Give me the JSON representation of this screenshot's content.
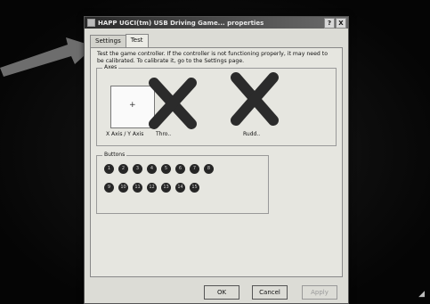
{
  "window": {
    "title": "HAPP UGCI(tm) USB Driving Game... properties",
    "help_label": "?",
    "close_label": "X"
  },
  "tabs": [
    {
      "label": "Settings",
      "active": false
    },
    {
      "label": "Test",
      "active": true
    }
  ],
  "test_panel": {
    "intro": "Test the game controller. If the controller is not functioning properly, it may need to be calibrated. To calibrate it, go to the Settings page.",
    "axes": {
      "label": "Axes",
      "xy_label": "X Axis / Y Axis",
      "crosshair": "+",
      "throttle_label": "Thro..",
      "rudder_label": "Rudd.."
    },
    "buttons": {
      "label": "Buttons",
      "items": [
        "1",
        "2",
        "3",
        "4",
        "5",
        "6",
        "7",
        "8",
        "9",
        "10",
        "11",
        "12",
        "13",
        "14",
        "15"
      ]
    }
  },
  "footer": {
    "ok": "OK",
    "cancel": "Cancel",
    "apply": "Apply"
  },
  "colors": {
    "x_mark": "#2b2b2b",
    "arrow": "#6d6d6d"
  }
}
